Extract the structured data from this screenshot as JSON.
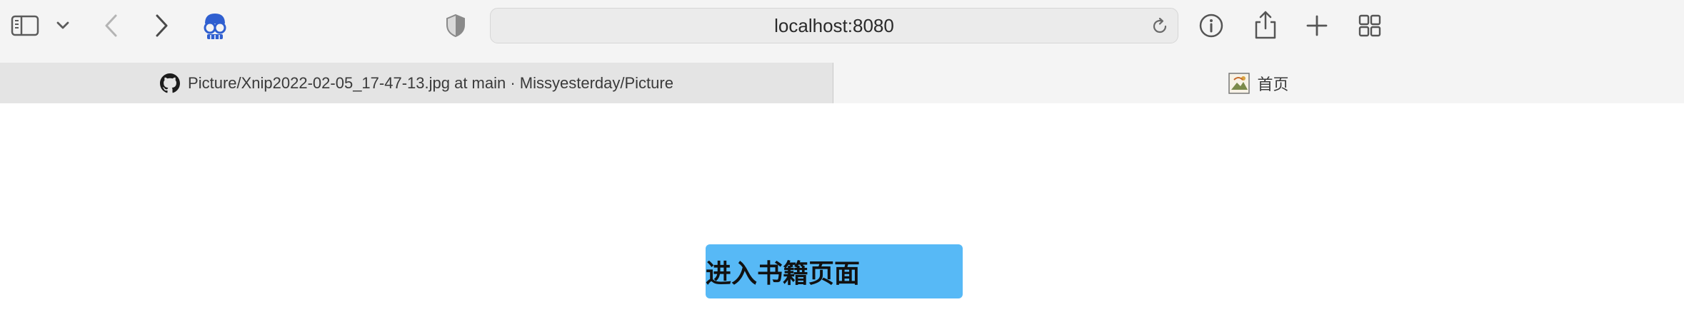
{
  "browser": {
    "address": "localhost:8080",
    "icons": {
      "sidebar": "sidebar-icon",
      "sidebar_menu": "chevron-down-icon",
      "back": "back-arrow-icon",
      "forward": "forward-arrow-icon",
      "extension": "extension-mascot-icon",
      "privacy": "shield-icon",
      "reload": "reload-icon",
      "info": "info-icon",
      "share": "share-icon",
      "new_tab": "plus-icon",
      "tab_overview": "grid-icon"
    }
  },
  "tabs": [
    {
      "title": "Picture/Xnip2022-02-05_17-47-13.jpg at main · Missyesterday/Picture",
      "icon": "github-icon",
      "active": true
    },
    {
      "title": "首页",
      "icon": "page-favicon-icon",
      "active": false
    }
  ],
  "page": {
    "button_label": "进入书籍页面",
    "button_color": "#57b9f6"
  }
}
